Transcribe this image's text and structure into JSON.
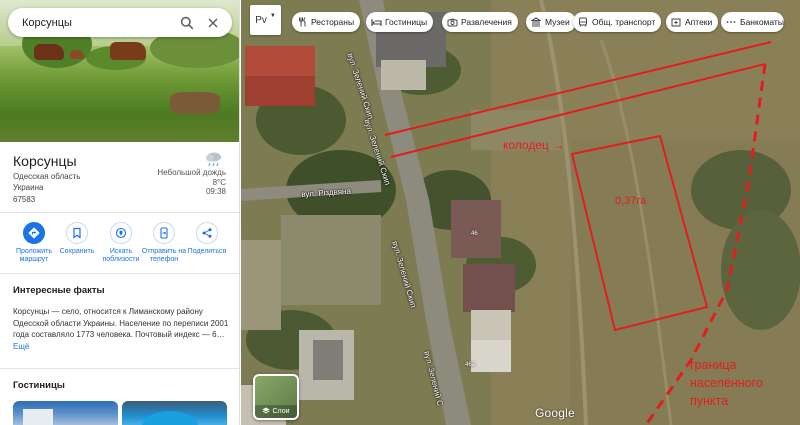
{
  "search": {
    "query": "Корсунцы"
  },
  "place": {
    "title": "Корсунцы",
    "region": "Одесская область",
    "country": "Украина",
    "postcode": "67583"
  },
  "weather": {
    "description": "Небольшой дождь",
    "temperature": "8°C",
    "time": "09:38",
    "icon": "rain-cloud-icon"
  },
  "actions": [
    {
      "label": "Проложить маршрут",
      "icon": "directions-icon"
    },
    {
      "label": "Сохранить",
      "icon": "bookmark-icon"
    },
    {
      "label": "Искать поблизости",
      "icon": "nearby-icon"
    },
    {
      "label": "Отправить на телефон",
      "icon": "phone-icon"
    },
    {
      "label": "Поделиться",
      "icon": "share-icon"
    }
  ],
  "facts": {
    "heading": "Интересные факты",
    "text": "Корсунцы — село, относится к Лиманскому району Одесской области Украины. Население по переписи 2001 года составляло 1773 человека. Почтовый индекс — 6…",
    "more": "Ещё"
  },
  "hotels": {
    "heading": "Гостиницы"
  },
  "map": {
    "lang_label": "Рv",
    "chips": [
      {
        "label": "Рестораны",
        "icon": "restaurant-icon"
      },
      {
        "label": "Гостиницы",
        "icon": "hotel-icon"
      },
      {
        "label": "Развлечения",
        "icon": "camera-icon"
      },
      {
        "label": "Музеи",
        "icon": "museum-icon"
      },
      {
        "label": "Общ. транспорт",
        "icon": "transit-icon"
      },
      {
        "label": "Аптеки",
        "icon": "pharmacy-icon"
      },
      {
        "label": "Банкоматы",
        "icon": "atm-icon"
      }
    ],
    "layers_label": "Слои",
    "google_label": "Google",
    "streets": {
      "zeleniy_skyp_top": "вул. Зелений Скип",
      "zeleniy_skyp_mid": "вул. Зелений Скип",
      "zeleniy_skyp_low": "вул. Зелений Скип",
      "zeleniy_skyp_bottom": "вул. Зелений С",
      "rizdviana": "вул. Різдвяна"
    },
    "house_numbers": [
      "46",
      "46а"
    ],
    "annotations": {
      "well": "колодец →",
      "area": "0,37га",
      "border": "граница населённого пункта"
    },
    "annotation_color": "#e01e1e"
  }
}
